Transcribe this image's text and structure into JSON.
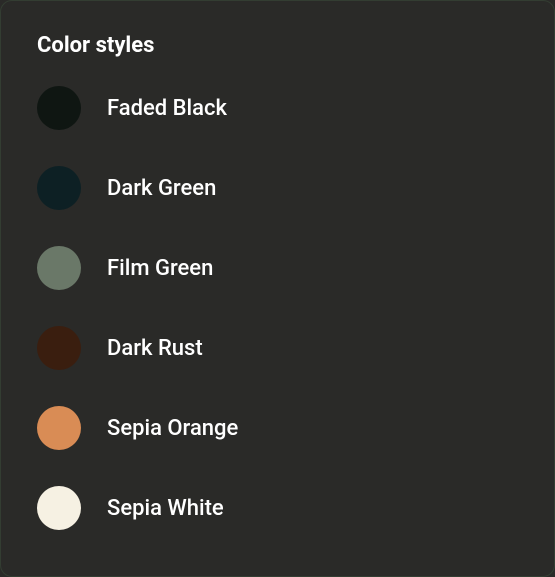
{
  "panel": {
    "title": "Color styles",
    "styles": [
      {
        "label": "Faded Black",
        "color": "#0f1612"
      },
      {
        "label": "Dark Green",
        "color": "#0d2024"
      },
      {
        "label": "Film Green",
        "color": "#6a7868"
      },
      {
        "label": "Dark Rust",
        "color": "#3a1e0f"
      },
      {
        "label": "Sepia Orange",
        "color": "#d98c55"
      },
      {
        "label": "Sepia White",
        "color": "#f6f1e3"
      }
    ]
  }
}
